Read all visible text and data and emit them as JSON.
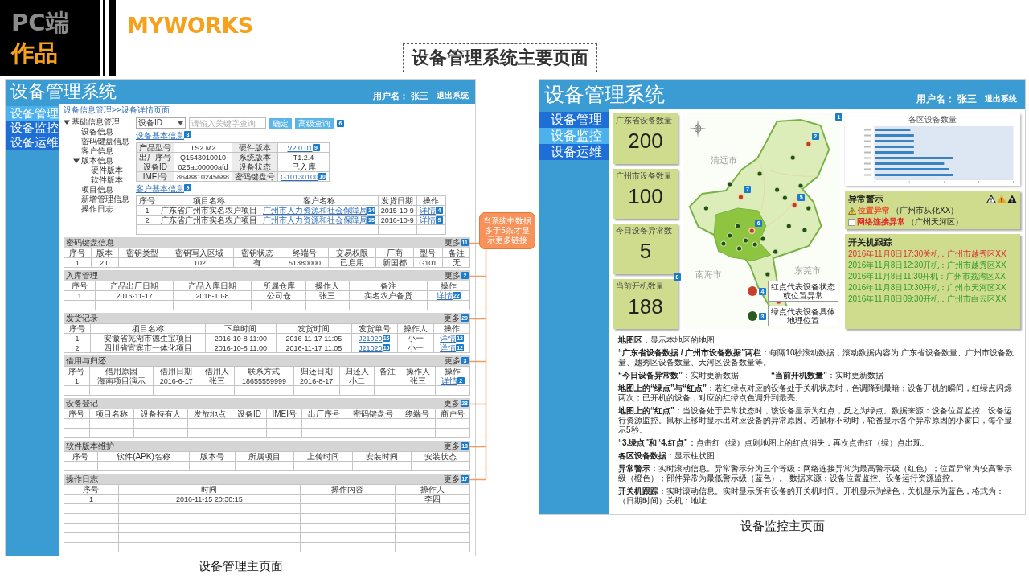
{
  "slide": {
    "label_top": "PC端",
    "label_bottom": "作品",
    "brand": "MYWORKS",
    "title": "设备管理系统主要页面"
  },
  "management_page": {
    "app_title": "设备管理系统",
    "user": "用户名： 张三",
    "logout": "退出系统",
    "sidebar": [
      {
        "label": "设备管理",
        "selected": true
      },
      {
        "label": "设备监控",
        "selected": false
      },
      {
        "label": "设备运维",
        "selected": false
      }
    ],
    "breadcrumb": "设备信息管理>>设备详情页面",
    "tree": [
      {
        "label": "基础信息管理",
        "expanded": true,
        "children": [
          {
            "label": "设备信息"
          },
          {
            "label": "密码键盘信息"
          },
          {
            "label": "客户信息"
          },
          {
            "label": "版本信息",
            "expanded": true,
            "children": [
              {
                "label": "硬件版本"
              },
              {
                "label": "软件版本"
              }
            ]
          },
          {
            "label": "项目信息"
          },
          {
            "label": "新增管理信息"
          },
          {
            "label": "操作日志"
          }
        ]
      }
    ],
    "search": {
      "filter": "设备ID",
      "placeholder": "请输入关键字查询",
      "buttons": [
        "确定",
        "高级查询"
      ],
      "badge": "6"
    },
    "device_info": {
      "title": "设备基本信息",
      "badge": "8",
      "rows": [
        [
          "产品型号",
          "TS2.M2",
          "硬件版本",
          {
            "kind": "link",
            "text": "V2.0.01",
            "badge": "9"
          }
        ],
        [
          "出厂序号",
          "Q1543010010",
          "系统版本",
          "T1.2.4"
        ],
        [
          "设备ID",
          "025ac00000afd",
          "设备状态",
          "已入库"
        ],
        [
          "IMEI号",
          "8648810245688",
          "密码键盘号",
          {
            "kind": "link",
            "text": "G10130100",
            "badge": "10"
          }
        ]
      ]
    },
    "customer_info": {
      "title": "客户基本信息",
      "badge": "9",
      "columns": [
        "序号",
        "项目名称",
        "客户名称",
        "发货日期",
        "操作"
      ],
      "rows": [
        [
          "1",
          "广东省广州市实名农户项目",
          {
            "kind": "link",
            "text": "广州市人力资源和社会保障局",
            "badge": "14"
          },
          "2015-10-9",
          {
            "kind": "link",
            "text": "详情",
            "badge": "4"
          }
        ],
        [
          "2",
          "广东省广州市实名农户项目",
          {
            "kind": "link",
            "text": "广州市人力资源和社会保障局",
            "badge": "15"
          },
          "2016-10-9",
          {
            "kind": "link",
            "text": "详情",
            "badge": "5"
          }
        ],
        [
          null,
          null,
          null,
          null,
          null
        ]
      ]
    },
    "sections": [
      {
        "title": "密码键盘信息",
        "more": "更多",
        "badge": "11",
        "columns": [
          "序号",
          "版本",
          "密钥类型",
          "密钥写入区域",
          "密钥状态",
          "终端号",
          "交易权限",
          "厂商",
          "型号",
          "备注"
        ],
        "rows": [
          [
            "1",
            "2.0",
            null,
            "102",
            "有",
            "51380000",
            "已启用",
            "新国都",
            "G101",
            "无"
          ]
        ]
      },
      {
        "title": "入库管理",
        "more": "更多",
        "badge": "2",
        "columns": [
          "序号",
          "产品出厂日期",
          "产品入库日期",
          "所属仓库",
          "操作人",
          "备注",
          "操作"
        ],
        "rows": [
          [
            "1",
            "2016-11-17",
            "2016-10-8",
            "公司仓",
            "张三",
            "实名农户备货",
            {
              "kind": "link",
              "text": "详情",
              "badge": "22"
            }
          ],
          [
            null,
            null,
            null,
            null,
            null,
            null,
            null
          ]
        ]
      },
      {
        "title": "发货记录",
        "more": "更多",
        "badge": "20",
        "columns": [
          "序号",
          "项目名称",
          "下单时间",
          "发货时间",
          "发货单号",
          "操作人",
          "操作"
        ],
        "rows": [
          [
            "1",
            "安徽省芜湖市德生宝项目",
            "2016-10-8 11:00",
            "2016-11-17 11:05",
            {
              "kind": "link",
              "text": "J21020",
              "badge": "16"
            },
            "小一",
            {
              "kind": "link",
              "text": "详情",
              "badge": "12"
            }
          ],
          [
            "2",
            "四川省宜宾市一体化项目",
            "2016-10-8 11:00",
            "2016-11-17 11:05",
            {
              "kind": "link",
              "text": "J21020",
              "badge": "15"
            },
            "小一",
            {
              "kind": "link",
              "text": "详情",
              "badge": "12"
            }
          ]
        ]
      },
      {
        "title": "借用与归还",
        "more": "更多",
        "badge": "3",
        "columns": [
          "序号",
          "借用原因",
          "借用日期",
          "借用人",
          "联系方式",
          "归还日期",
          "归还人",
          "备注",
          "操作人",
          "操作"
        ],
        "rows": [
          [
            "1",
            "海南项目演示",
            "2016-6-17",
            "张三",
            "18655559999",
            "2016-8-17",
            "小二",
            null,
            "张三",
            {
              "kind": "link",
              "text": "详情",
              "badge": "2"
            }
          ],
          [
            null,
            null,
            null,
            null,
            null,
            null,
            null,
            null,
            null,
            null
          ]
        ]
      },
      {
        "title": "设备登记",
        "more": "更多",
        "badge": "28",
        "columns": [
          "序号",
          "项目名称",
          "设备持有人",
          "发放地点",
          "设备ID",
          "IMEI号",
          "出厂序号",
          "密码键盘号",
          "终端号",
          "商户号"
        ],
        "rows": [
          [
            null,
            null,
            null,
            null,
            null,
            null,
            null,
            null,
            null,
            null
          ],
          [
            null,
            null,
            null,
            null,
            null,
            null,
            null,
            null,
            null,
            null
          ]
        ]
      },
      {
        "title": "软件版本维护",
        "more": "更多",
        "badge": "18",
        "columns": [
          "序号",
          "软件(APK)名称",
          "版本号",
          "所属项目",
          "上传时间",
          "安装时间",
          "安装状态"
        ],
        "rows": [
          [
            null,
            null,
            null,
            null,
            null,
            null,
            null
          ]
        ]
      },
      {
        "title": "操作日志",
        "more": "更多",
        "badge": "17",
        "columns": [
          "序号",
          "时间",
          "操作内容",
          "操作人"
        ],
        "rows": [
          [
            "1",
            "2016-11-15 20:30:15",
            null,
            "李四"
          ],
          [
            null,
            null,
            null,
            null
          ],
          [
            null,
            null,
            null,
            null
          ],
          [
            null,
            null,
            null,
            null
          ],
          [
            null,
            null,
            null,
            null
          ],
          [
            null,
            null,
            null,
            null
          ]
        ]
      }
    ],
    "caption": "设备管理主页面"
  },
  "annotation": "当系统中数据多于5条才显示更多链接",
  "monitoring_page": {
    "app_title": "设备管理系统",
    "user": "用户名： 张三",
    "logout": "退出系统",
    "sidebar": [
      {
        "label": "设备管理",
        "selected": false
      },
      {
        "label": "设备监控",
        "selected": true
      },
      {
        "label": "设备运维",
        "selected": false
      }
    ],
    "stats": [
      {
        "label": "广东省设备数量",
        "value": "200"
      },
      {
        "label": "广州市设备数量",
        "value": "100"
      },
      {
        "label": "今日设备异常数",
        "value": "5"
      },
      {
        "label": "当前开机数量",
        "value": "188",
        "badge": "8"
      }
    ],
    "map": {
      "labels": [
        "清远市",
        "东莞市",
        "南海市"
      ],
      "badges": [
        "2",
        "7",
        "5",
        "6"
      ],
      "legend": [
        {
          "text": "红点代表设备状态或位置异常",
          "badge": "4",
          "color": "#c8402a"
        },
        {
          "text": "绿点代表设备具体地理位置",
          "badge": "3",
          "color": "#2a5a1e"
        }
      ]
    },
    "district_chart": {
      "title": "各区设备数量",
      "badge": "1"
    },
    "alerts": {
      "title": "异常警示",
      "items": [
        {
          "kind": "triangle",
          "type": "位置异常",
          "place": "（广州市从化XX）",
          "color": "#e8502a"
        },
        {
          "kind": "square",
          "type": "网络连接异常",
          "place": "（广州天河区）",
          "color": "#e02828"
        }
      ]
    },
    "power_log": {
      "title": "开关机跟踪",
      "entries": [
        {
          "text": "2016年11月8日17:30关机：广州市越秀区XX",
          "on": false
        },
        {
          "text": "2016年11月8日12:30开机：广州市越秀区XX",
          "on": true
        },
        {
          "text": "2016年11月8日11:30开机：广州市荔湾区XX",
          "on": true
        },
        {
          "text": "2016年11月8日10:30开机：广州市天河区XX",
          "on": true
        },
        {
          "text": "2016年11月8日09:30开机：广州市白云区XX",
          "on": true
        }
      ]
    },
    "notes": [
      {
        "text": "**地图区**：显示本地区的地图"
      },
      {
        "text": "**“广东省设备数据 / 广州市设备数据”两栏**：每隔10秒滚动数据，滚动数据内容为 广东省设备数量、广州市设备数量、越秀区设备数量、天河区设备数量等。"
      },
      {
        "text": "**“今日设备异常数”**：实时更新数据",
        "aside": "**“当前开机数量”**：实时更新数据"
      },
      {
        "text": "**地图上的“绿点”与“红点”**：若红绿点对应的设备处于关机状态时，色调降到最暗；设备开机的瞬间，红绿点闪烁两次；已开机的设备，对应的红绿点色调升到最亮。"
      },
      {
        "text": "**地图上的“红点”**：当设备处于异常状态时，该设备显示为红点，反之为绿点。数据来源：设备位置监控、设备运行资源监控。鼠标上移时显示出对应设备的异常原因。若鼠标不动时，轮番显示各个异常原因的小窗口，每个显示5秒。"
      },
      {
        "text": "**“3.绿点”和“4.红点”**：点击红（绿）点则地图上的红点消失，再次点击红（绿）点出现。"
      },
      {
        "text": "**各区设备数据**：显示柱状图"
      },
      {
        "text": "**异常警示**：实时滚动信息。异常警示分为三个等级：网络连接异常为最高警示级（红色）；位置异常为较高警示级（橙色）；部件异常为最低警示级（蓝色）。 数据来源：设备位置监控、设备运行资源监控。"
      },
      {
        "text": "**开关机跟踪**：实时滚动信息。实时显示所有设备的开关机时间。开机显示为绿色，关机显示为蓝色，格式为：（日期时间）关机：地址"
      }
    ],
    "caption": "设备监控主页面"
  }
}
